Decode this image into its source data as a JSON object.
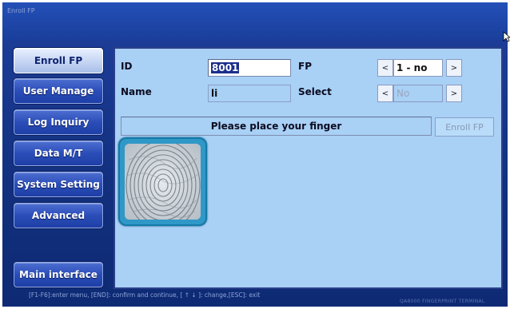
{
  "window": {
    "title": "Enroll FP"
  },
  "sidebar": {
    "items": [
      {
        "label": "Enroll FP"
      },
      {
        "label": "User Manage"
      },
      {
        "label": "Log Inquiry"
      },
      {
        "label": "Data M/T"
      },
      {
        "label": "System Setting"
      },
      {
        "label": "Advanced"
      },
      {
        "label": "Main interface"
      }
    ]
  },
  "form": {
    "id_label": "ID",
    "id_value": "8001",
    "name_label": "Name",
    "name_value": "li",
    "fp_label": "FP",
    "fp_prev": "<",
    "fp_value": "1 - no",
    "fp_next": ">",
    "select_label": "Select",
    "select_prev": "<",
    "select_value": "No",
    "select_next": ">"
  },
  "status": {
    "message": "Please place your finger"
  },
  "enroll_button": {
    "label": "Enroll FP"
  },
  "footer": {
    "help": "[F1-F6]:enter menu, [END]: confirm and continue, [ ↑ ↓ ]: change,[ESC]: exit",
    "brand": "QA8000 FINGERPRINT TERMINAL"
  },
  "colors": {
    "panel_bg": "#a9d0f5",
    "window_bg": "#1a3e9a",
    "frame_accent": "#2f98c7"
  },
  "icons": {
    "cursor": "mouse-pointer-icon",
    "fingerprint": "fingerprint-image"
  }
}
